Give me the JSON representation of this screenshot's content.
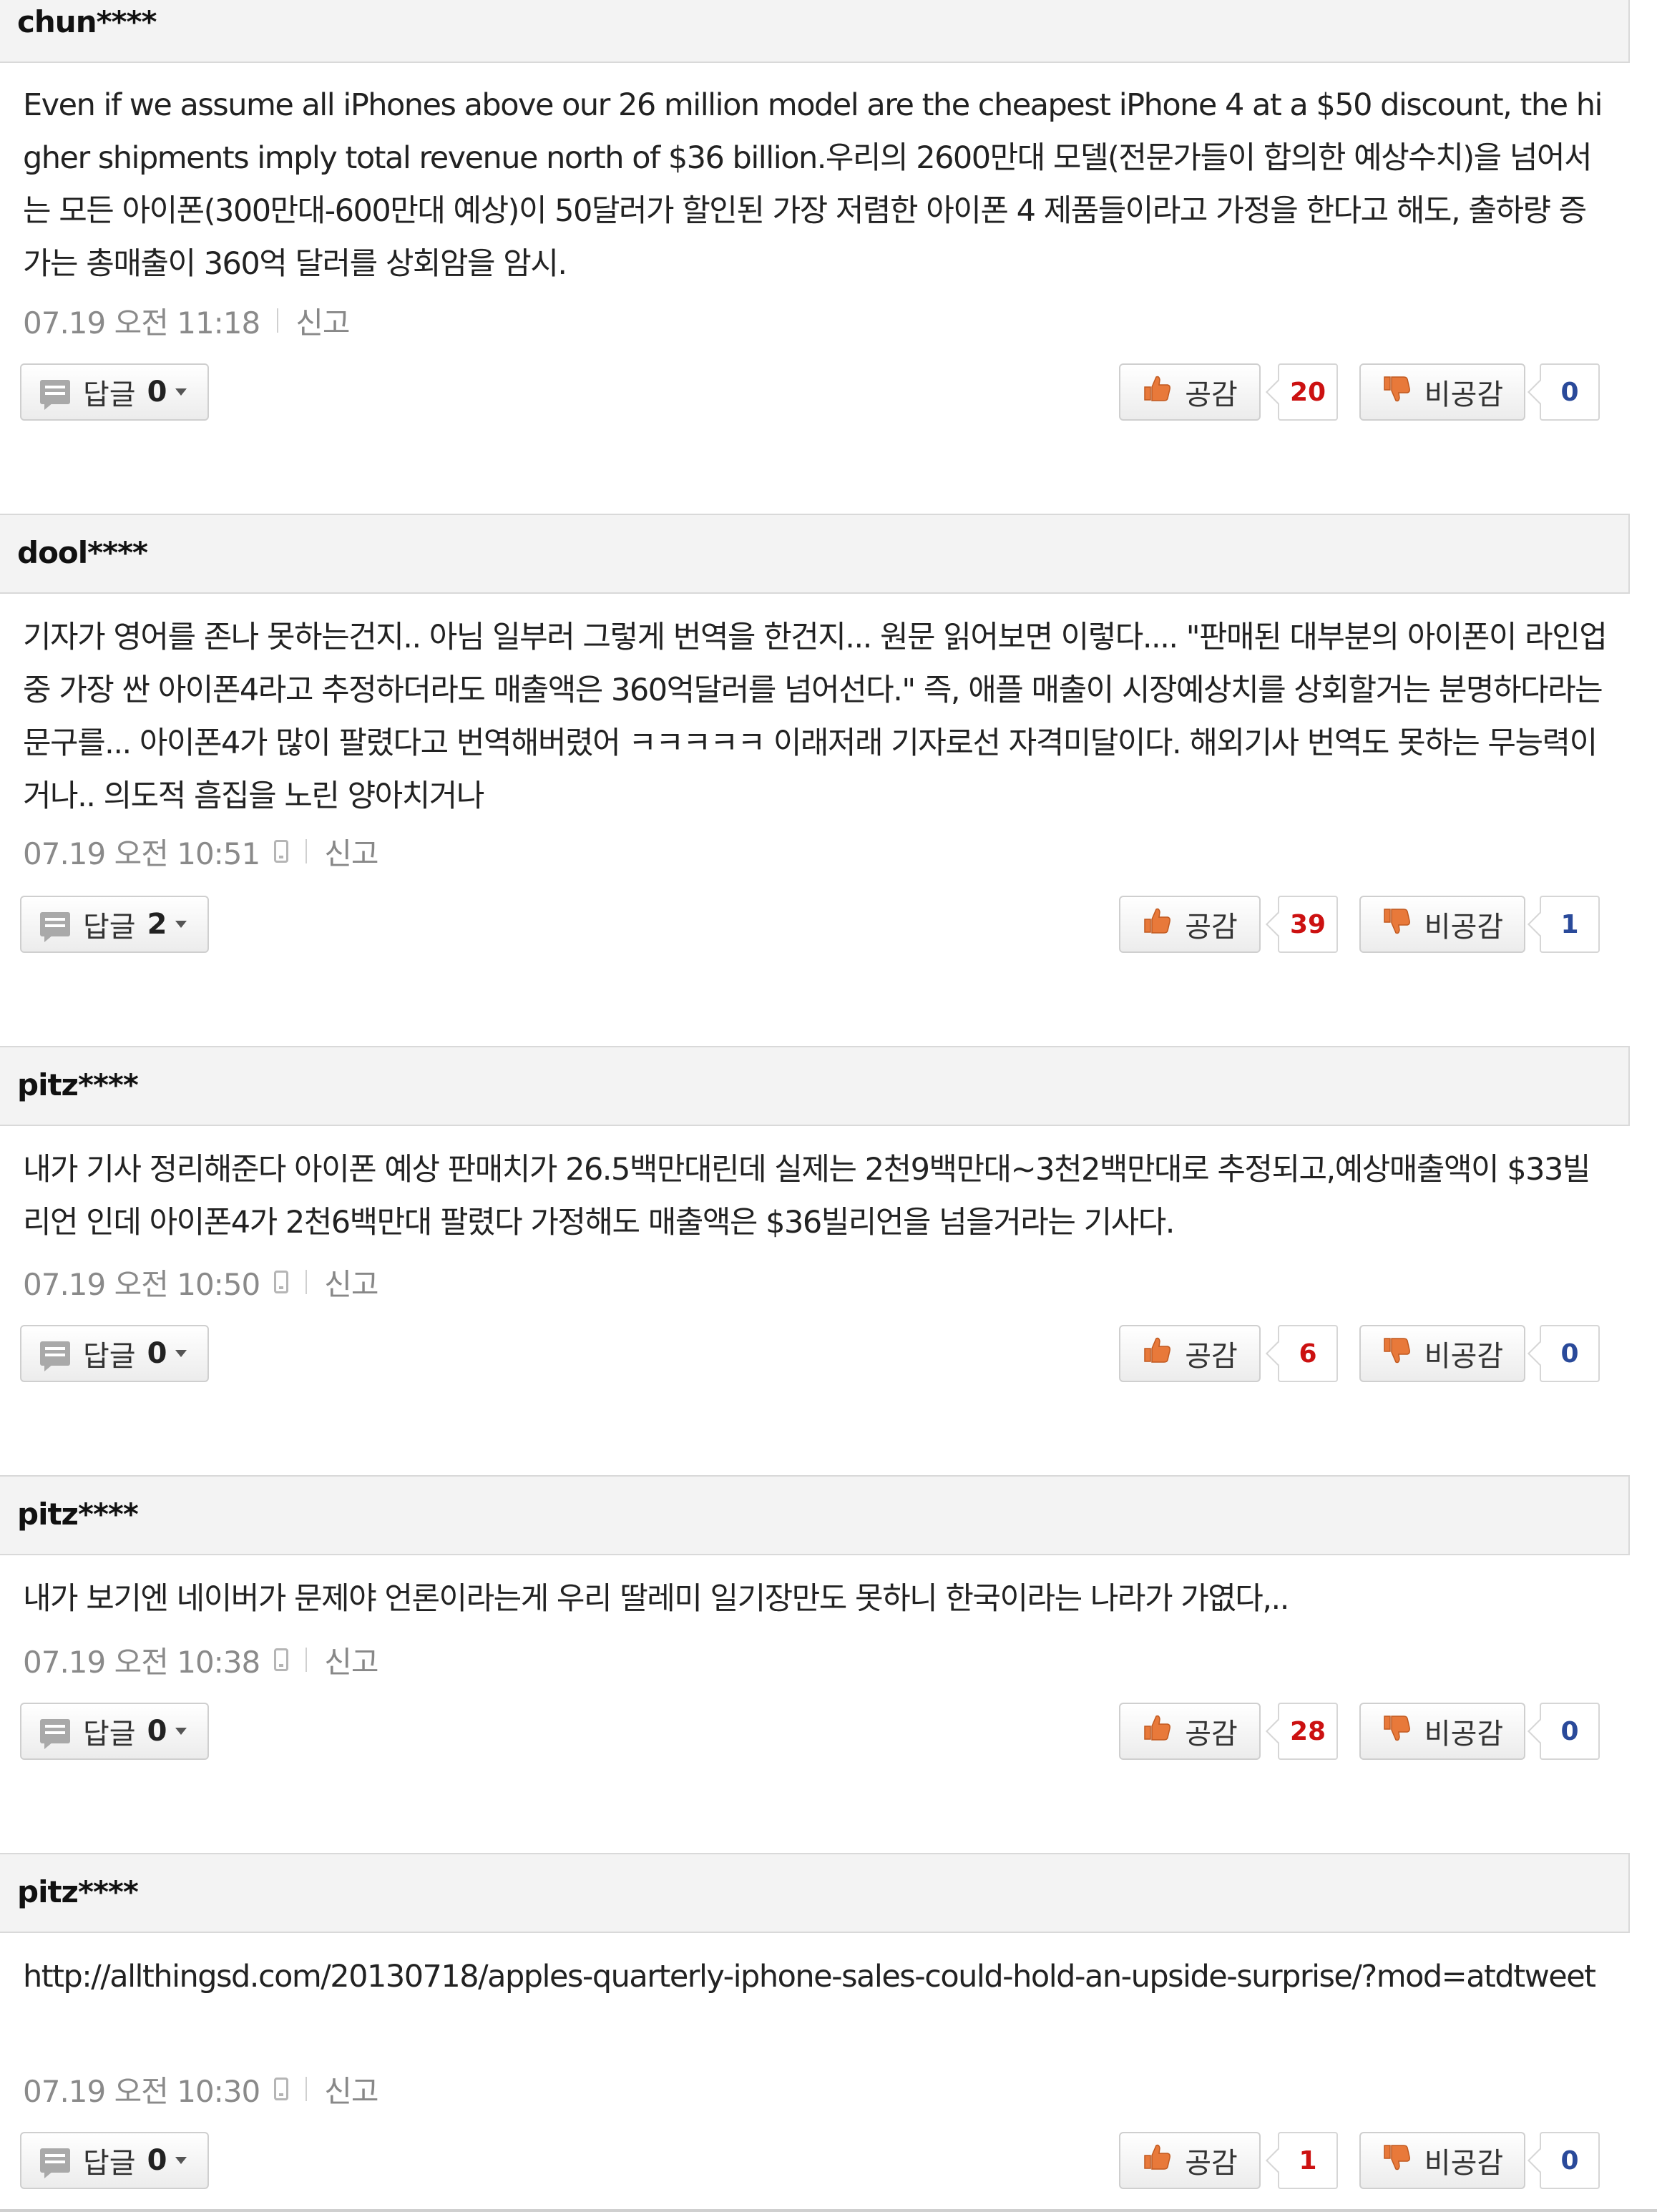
{
  "ui": {
    "reply_label": "답글",
    "like_label": "공감",
    "dislike_label": "비공감",
    "report_label": "신고"
  },
  "colors": {
    "like_count": "#cc1111",
    "dislike_count": "#2a4a9a",
    "thumb_up": "#e8793a",
    "thumb_down": "#e8793a"
  },
  "comments": [
    {
      "author": "chun****",
      "text": "Even if we assume all iPhones above our 26 million model are the cheapest iPhone 4 at a $50 discount, the higher shipments imply total revenue north of $36 billion.우리의 2600만대 모델(전문가들이 합의한 예상수치)을 넘어서는 모든 아이폰(300만대-600만대 예상)이 50달러가 할인된 가장 저렴한 아이폰 4 제품들이라고 가정을 한다고 해도, 출하량 증가는 총매출이 360억 달러를 상회암을 암시.",
      "timestamp": "07.19 오전 11:18",
      "mobile": false,
      "reply_count": "0",
      "likes": "20",
      "dislikes": "0"
    },
    {
      "author": "dool****",
      "text": "기자가 영어를 존나 못하는건지.. 아님 일부러 그렇게 번역을 한건지... 원문 읽어보면 이렇다.... \"판매된 대부분의 아이폰이 라인업중 가장 싼 아이폰4라고 추정하더라도 매출액은 360억달러를 넘어선다.\" 즉, 애플 매출이 시장예상치를 상회할거는 분명하다라는 문구를... 아이폰4가 많이 팔렸다고 번역해버렸어 ㅋㅋㅋㅋㅋ 이래저래 기자로선 자격미달이다. 해외기사 번역도 못하는 무능력이거나.. 의도적 흠집을 노린 양아치거나",
      "timestamp": "07.19 오전 10:51",
      "mobile": true,
      "reply_count": "2",
      "likes": "39",
      "dislikes": "1"
    },
    {
      "author": "pitz****",
      "text": "내가 기사 정리해준다 아이폰 예상 판매치가 26.5백만대린데 실제는 2천9백만대~3천2백만대로 추정되고,예상매출액이 $33빌리언 인데 아이폰4가 2천6백만대 팔렸다 가정해도 매출액은 $36빌리언을 넘을거라는 기사다.",
      "timestamp": "07.19 오전 10:50",
      "mobile": true,
      "reply_count": "0",
      "likes": "6",
      "dislikes": "0"
    },
    {
      "author": "pitz****",
      "text": "내가 보기엔 네이버가 문제야 언론이라는게 우리 딸레미 일기장만도 못하니 한국이라는 나라가 가엾다,..",
      "timestamp": "07.19 오전 10:38",
      "mobile": true,
      "reply_count": "0",
      "likes": "28",
      "dislikes": "0"
    },
    {
      "author": "pitz****",
      "text": "http://allthingsd.com/20130718/apples-quarterly-iphone-sales-could-hold-an-upside-surprise/?mod=atdtweet",
      "timestamp": "07.19 오전 10:30",
      "mobile": true,
      "reply_count": "0",
      "likes": "1",
      "dislikes": "0"
    }
  ]
}
